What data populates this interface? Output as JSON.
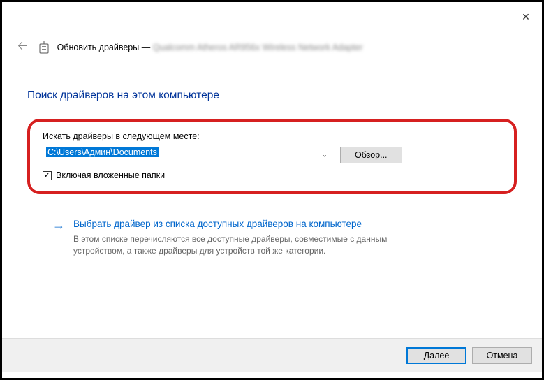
{
  "titlebar": {
    "close_icon": "✕"
  },
  "header": {
    "back_icon": "🡠",
    "title_prefix": "Обновить драйверы — ",
    "device_name": "Qualcomm Atheros AR956x Wireless Network Adapter"
  },
  "page": {
    "title": "Поиск драйверов на этом компьютере",
    "search_label": "Искать драйверы в следующем месте:",
    "path_value": "C:\\Users\\Админ\\Documents",
    "browse_label": "Обзор...",
    "checkbox_checked": true,
    "checkbox_label": "Включая вложенные папки"
  },
  "link": {
    "arrow": "→",
    "title": "Выбрать драйвер из списка доступных драйверов на компьютере",
    "description": "В этом списке перечисляются все доступные драйверы, совместимые с данным устройством, а также драйверы для устройств той же категории."
  },
  "footer": {
    "next_label": "Далее",
    "cancel_label": "Отмена"
  }
}
